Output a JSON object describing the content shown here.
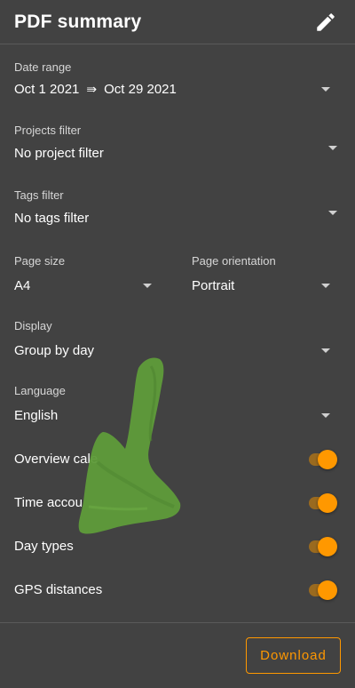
{
  "header": {
    "title": "PDF summary",
    "edit_icon": "pencil-icon"
  },
  "date_range": {
    "label": "Date range",
    "start": "Oct 1 2021",
    "separator": "⇛",
    "end": "Oct 29 2021"
  },
  "projects_filter": {
    "label": "Projects filter",
    "value": "No project filter"
  },
  "tags_filter": {
    "label": "Tags filter",
    "value": "No tags filter"
  },
  "page_size": {
    "label": "Page size",
    "value": "A4"
  },
  "page_orientation": {
    "label": "Page orientation",
    "value": "Portrait"
  },
  "display": {
    "label": "Display",
    "value": "Group by day"
  },
  "language": {
    "label": "Language",
    "value": "English"
  },
  "toggles": [
    {
      "label": "Overview cale",
      "on": true
    },
    {
      "label": "Time accou",
      "on": true
    },
    {
      "label": "Day types",
      "on": true
    },
    {
      "label": "GPS distances",
      "on": true
    }
  ],
  "footer": {
    "download_label": "Download"
  },
  "colors": {
    "background": "#424242",
    "accent": "#ff9800",
    "divider": "#5a5a5a",
    "scribble": "#5f9b3a"
  }
}
